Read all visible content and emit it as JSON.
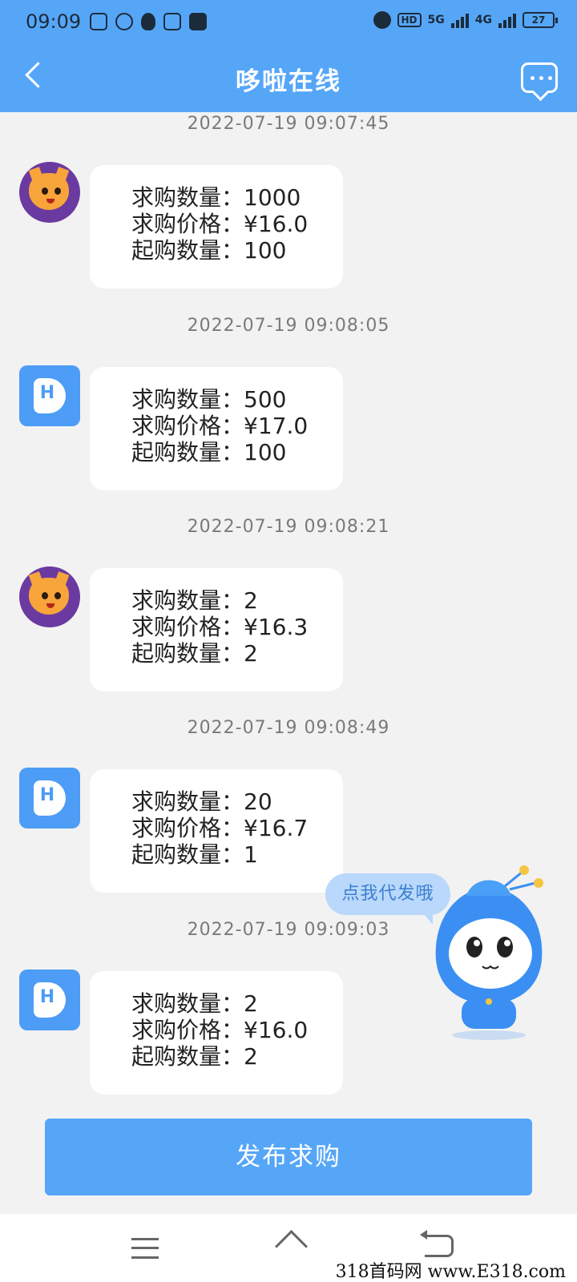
{
  "status_bar": {
    "time": "09:09",
    "network_hd": "HD",
    "network_5g": "5G",
    "network_4g": "4G",
    "battery": "27"
  },
  "header": {
    "title": "哆啦在线"
  },
  "messages": [
    {
      "timestamp": "2022-07-19  09:07:45",
      "sender": "cat-avatar",
      "qty_label": "求购数量：",
      "qty": "1000",
      "price_label": "求购价格：",
      "price": "¥16.0",
      "min_label": "起购数量：",
      "min": "100"
    },
    {
      "timestamp": "2022-07-19  09:08:05",
      "sender": "app-avatar",
      "qty_label": "求购数量：",
      "qty": "500",
      "price_label": "求购价格：",
      "price": "¥17.0",
      "min_label": "起购数量：",
      "min": "100"
    },
    {
      "timestamp": "2022-07-19  09:08:21",
      "sender": "cat-avatar",
      "qty_label": "求购数量：",
      "qty": "2",
      "price_label": "求购价格：",
      "price": "¥16.3",
      "min_label": "起购数量：",
      "min": "2"
    },
    {
      "timestamp": "2022-07-19  09:08:49",
      "sender": "app-avatar",
      "qty_label": "求购数量：",
      "qty": "20",
      "price_label": "求购价格：",
      "price": "¥16.7",
      "min_label": "起购数量：",
      "min": "1"
    },
    {
      "timestamp": "2022-07-19  09:09:03",
      "sender": "app-avatar",
      "qty_label": "求购数量：",
      "qty": "2",
      "price_label": "求购价格：",
      "price": "¥16.0",
      "min_label": "起购数量：",
      "min": "2"
    }
  ],
  "app_avatar_letter": "H",
  "mascot": {
    "hint": "点我代发哦"
  },
  "publish_button": "发布求购",
  "watermark": "318首码网  www.E318.com",
  "colors": {
    "primary": "#56a6f8",
    "background": "#f2f2f2",
    "bubble": "#ffffff"
  }
}
